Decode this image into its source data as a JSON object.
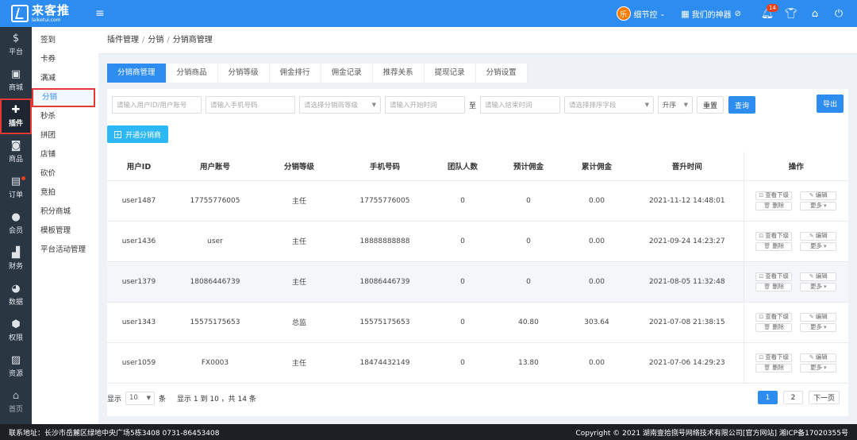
{
  "app": {
    "logo_cn": "来客推",
    "logo_en": "laiketui.com",
    "menu_toggle": "≡"
  },
  "header": {
    "avatar_char": "乐",
    "user_name": "细节控",
    "helper_label": "我们的神器",
    "notification_count": "14"
  },
  "sidebar": [
    {
      "label": "平台",
      "icon": "$"
    },
    {
      "label": "商城",
      "icon": "▣"
    },
    {
      "label": "插件",
      "icon": "✚"
    },
    {
      "label": "商品",
      "icon": "◙"
    },
    {
      "label": "订单",
      "icon": "▤"
    },
    {
      "label": "会员",
      "icon": "●"
    },
    {
      "label": "财务",
      "icon": "▟"
    },
    {
      "label": "数据",
      "icon": "◕"
    },
    {
      "label": "权限",
      "icon": "⬢"
    },
    {
      "label": "资源",
      "icon": "▨"
    },
    {
      "label": "首页",
      "icon": "⌂"
    }
  ],
  "submenu": [
    "签到",
    "卡券",
    "满减",
    "分销",
    "秒杀",
    "拼团",
    "店铺",
    "砍价",
    "竞拍",
    "积分商城",
    "模板管理",
    "平台活动管理"
  ],
  "breadcrumb": [
    "插件管理",
    "分销",
    "分销商管理"
  ],
  "tabs": [
    "分销商管理",
    "分销商品",
    "分销等级",
    "佣金排行",
    "佣金记录",
    "推荐关系",
    "提现记录",
    "分销设置"
  ],
  "filters": {
    "user_ph": "请输入用户ID/用户账号",
    "phone_ph": "请输入手机号码",
    "level_ph": "请选择分销商等级",
    "start_ph": "请输入开始时间",
    "to": "至",
    "end_ph": "请输入结束时间",
    "sort_ph": "请选择排序字段",
    "order_val": "升序",
    "reset": "重置",
    "query": "查询",
    "export": "导出"
  },
  "open_btn": "开通分销商",
  "table": {
    "headers": [
      "用户ID",
      "用户账号",
      "分销等级",
      "手机号码",
      "团队人数",
      "预计佣金",
      "累计佣金",
      "晋升时间",
      "操作"
    ],
    "rows": [
      [
        "user1487",
        "17755776005",
        "主任",
        "17755776005",
        "0",
        "0",
        "0.00",
        "2021-11-12 14:48:01"
      ],
      [
        "user1436",
        "user",
        "主任",
        "18888888888",
        "0",
        "0",
        "0.00",
        "2021-09-24 14:23:27"
      ],
      [
        "user1379",
        "18086446739",
        "主任",
        "18086446739",
        "0",
        "0",
        "0.00",
        "2021-08-05 11:32:48"
      ],
      [
        "user1343",
        "15575175653",
        "总监",
        "15575175653",
        "0",
        "40.80",
        "303.64",
        "2021-07-08 21:38:15"
      ],
      [
        "user1059",
        "FX0003",
        "主任",
        "18474432149",
        "0",
        "13.80",
        "0.00",
        "2021-07-06 14:29:23"
      ]
    ],
    "ops": {
      "view": "查看下级",
      "edit": "编辑",
      "delete": "删除",
      "more": "更多"
    }
  },
  "pager": {
    "show": "显示",
    "page_size": "10",
    "unit": "条",
    "info": "显示 1 到 10 ，共 14 条",
    "pages": [
      "1",
      "2"
    ],
    "next": "下一页"
  },
  "footer": {
    "address": "联系地址：长沙市岳麓区绿地中央广场5栋3408 0731-86453408",
    "copyright": "Copyright © 2021 湖南壹拾捌号网络技术有限公司[官方网站]  湘ICP备17020355号"
  },
  "colors": {
    "primary": "#2d8cf0",
    "sidebar": "#2b3643",
    "highlight": "#e53935"
  }
}
